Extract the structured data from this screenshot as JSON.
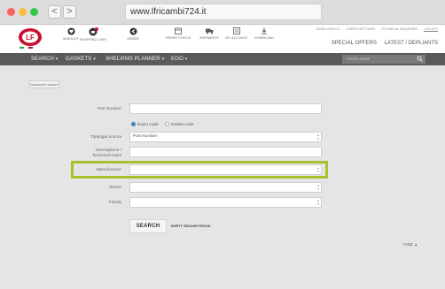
{
  "browser": {
    "url": "www.lfricambi724.it",
    "back": "<",
    "forward": ">"
  },
  "header": {
    "icons": [
      {
        "label": "WISHLIST",
        "icon": "heart-icon"
      },
      {
        "label": "SHOPPING CART",
        "icon": "cart-icon"
      },
      {
        "label": "ORDER",
        "icon": "order-icon"
      },
      {
        "label": "ORDER STATUS",
        "icon": "calendar-icon"
      },
      {
        "label": "SHIPMENTS",
        "icon": "truck-icon"
      },
      {
        "label": "MY ACCOUNT",
        "icon": "account-icon"
      },
      {
        "label": "DOWNLOAD",
        "icon": "download-icon"
      }
    ],
    "toplinks": [
      "DEMO USER LF",
      "USER'S SETTINGS",
      "TECHNICAL ENQUIRIES",
      "LOG OUT"
    ],
    "offers": [
      "SPECIAL OFFERS",
      "LATEST / DEPLIANTS"
    ],
    "brand_color": "#c8102e"
  },
  "menu": {
    "items": [
      "SEARCH",
      "GASKETS",
      "SHELVING PLANNER",
      "EGO"
    ],
    "search_placeholder": "Find in name"
  },
  "form": {
    "advanced_search": "Advanced search",
    "part_number_label": "Part Number",
    "part_number_value": "",
    "radio_exact": "Exact code",
    "radio_partial": "Partial code",
    "tipologia_label": "Tipologia ricerca",
    "tipologia_value": "Part Number",
    "descriptions_label_1": "Descriptions /",
    "descriptions_label_2": "Technical notes",
    "descriptions_value": "",
    "manufacturer_label": "Manufacturer",
    "manufacturer_value": "",
    "sector_label": "Sector",
    "sector_value": "",
    "family_label": "Family",
    "family_value": "",
    "search_button": "SEARCH",
    "empty_fields": "EMPTY SEACHE FIELDS",
    "hide": "HIDE",
    "highlight_color": "#a6c22e"
  }
}
